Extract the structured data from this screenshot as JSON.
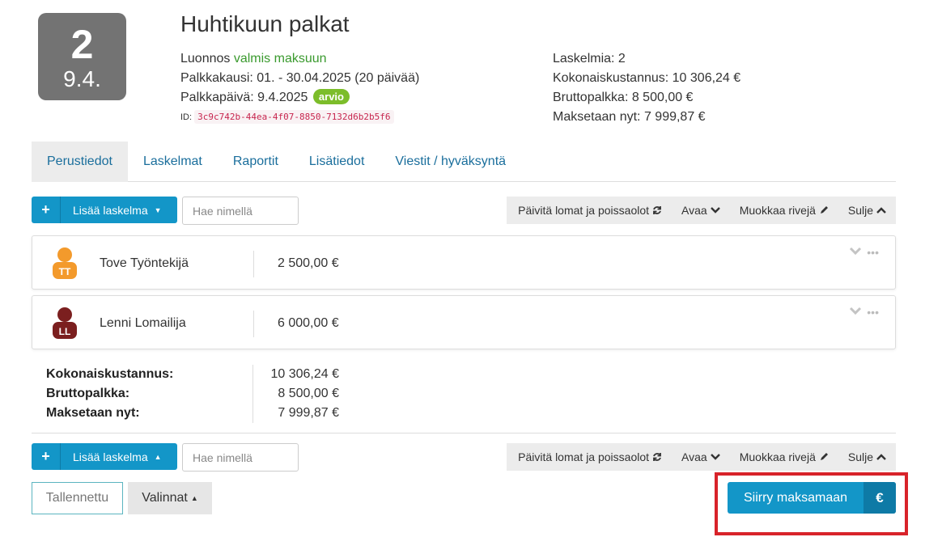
{
  "header": {
    "badge_number": "2",
    "badge_date": "9.4.",
    "title": "Huhtikuun palkat",
    "status_prefix": "Luonnos",
    "status_ready": "valmis maksuun",
    "period": "Palkkakausi: 01. - 30.04.2025 (20 päivää)",
    "payday": "Palkkapäivä: 9.4.2025",
    "payday_badge": "arvio",
    "id_label": "ID:",
    "id_value": "3c9c742b-44ea-4f07-8850-7132d6b2b5f6",
    "calc_count": "Laskelmia: 2",
    "total_cost": "Kokonaiskustannus: 10 306,24 €",
    "gross": "Bruttopalkka: 8 500,00 €",
    "pay_now": "Maksetaan nyt: 7 999,87 €"
  },
  "tabs": [
    {
      "label": "Perustiedot"
    },
    {
      "label": "Laskelmat"
    },
    {
      "label": "Raportit"
    },
    {
      "label": "Lisätiedot"
    },
    {
      "label": "Viestit / hyväksyntä"
    }
  ],
  "toolbar": {
    "add_label": "Lisää laskelma",
    "search_placeholder": "Hae nimellä",
    "refresh_label": "Päivitä lomat ja poissaolot",
    "open_label": "Avaa",
    "edit_label": "Muokkaa rivejä",
    "close_label": "Sulje"
  },
  "employees": [
    {
      "name": "Tove Työntekijä",
      "initials": "TT",
      "amount": "2 500,00 €",
      "color": "#f39a2c"
    },
    {
      "name": "Lenni Lomailija",
      "initials": "LL",
      "amount": "6 000,00 €",
      "color": "#7b1f1f"
    }
  ],
  "summary": {
    "total_cost_label": "Kokonaiskustannus:",
    "total_cost_value": "10 306,24 €",
    "gross_label": "Bruttopalkka:",
    "gross_value": "8 500,00 €",
    "pay_now_label": "Maksetaan nyt:",
    "pay_now_value": "7 999,87 €"
  },
  "bottom": {
    "saved_label": "Tallennettu",
    "options_label": "Valinnat",
    "pay_label": "Siirry maksamaan",
    "pay_icon": "€"
  },
  "colors": {
    "accent": "#1396c8",
    "badge_green": "#7cbd2a",
    "highlight": "#d8232a"
  }
}
